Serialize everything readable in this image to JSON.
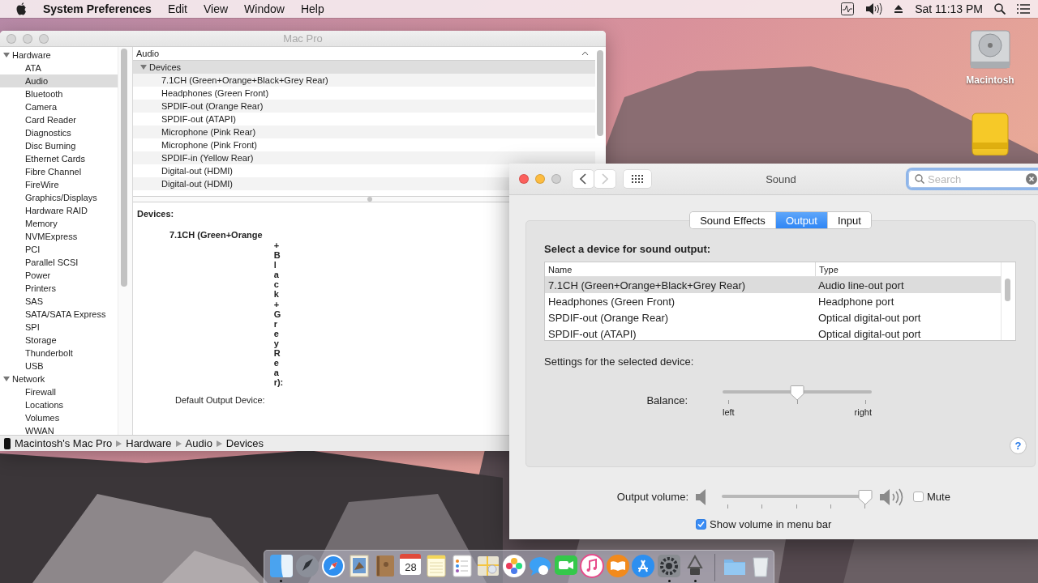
{
  "menu_bar": {
    "app_name": "System Preferences",
    "menus": [
      "Edit",
      "View",
      "Window",
      "Help"
    ],
    "clock": "Sat 11:13 PM"
  },
  "desktop_icons": [
    {
      "kind": "internal-drive",
      "label": "Macintosh"
    },
    {
      "kind": "external-drive"
    }
  ],
  "info_window": {
    "title": "Mac Pro",
    "sidebar": [
      {
        "label": "Hardware",
        "expanded": true,
        "children": [
          {
            "label": "ATA",
            "selected": false
          },
          {
            "label": "Audio",
            "selected": true
          },
          {
            "label": "Bluetooth",
            "selected": false
          },
          {
            "label": "Camera",
            "selected": false
          },
          {
            "label": "Card Reader",
            "selected": false
          },
          {
            "label": "Diagnostics",
            "selected": false
          },
          {
            "label": "Disc Burning",
            "selected": false
          },
          {
            "label": "Ethernet Cards",
            "selected": false
          },
          {
            "label": "Fibre Channel",
            "selected": false
          },
          {
            "label": "FireWire",
            "selected": false
          },
          {
            "label": "Graphics/Displays",
            "selected": false
          },
          {
            "label": "Hardware RAID",
            "selected": false
          },
          {
            "label": "Memory",
            "selected": false
          },
          {
            "label": "NVMExpress",
            "selected": false
          },
          {
            "label": "PCI",
            "selected": false
          },
          {
            "label": "Parallel SCSI",
            "selected": false
          },
          {
            "label": "Power",
            "selected": false
          },
          {
            "label": "Printers",
            "selected": false
          },
          {
            "label": "SAS",
            "selected": false
          },
          {
            "label": "SATA/SATA Express",
            "selected": false
          },
          {
            "label": "SPI",
            "selected": false
          },
          {
            "label": "Storage",
            "selected": false
          },
          {
            "label": "Thunderbolt",
            "selected": false
          },
          {
            "label": "USB",
            "selected": false
          }
        ]
      },
      {
        "label": "Network",
        "expanded": true,
        "children": [
          {
            "label": "Firewall",
            "selected": false
          },
          {
            "label": "Locations",
            "selected": false
          },
          {
            "label": "Volumes",
            "selected": false
          },
          {
            "label": "WWAN",
            "selected": false
          }
        ]
      }
    ],
    "list_header": "Audio",
    "list": [
      {
        "label": "Devices",
        "expanded": true,
        "children": [
          {
            "label": "7.1CH (Green+Orange+Black+Grey Rear)"
          },
          {
            "label": "Headphones (Green Front)"
          },
          {
            "label": "SPDIF-out (Orange Rear)"
          },
          {
            "label": "SPDIF-out (ATAPI)"
          },
          {
            "label": "Microphone (Pink Rear)"
          },
          {
            "label": "Microphone (Pink Front)"
          },
          {
            "label": "SPDIF-in (Yellow Rear)"
          },
          {
            "label": "Digital-out (HDMI)"
          },
          {
            "label": "Digital-out (HDMI)"
          }
        ]
      }
    ],
    "detail": {
      "heading": "Devices:",
      "device_name": "7.1CH (Green+Orange",
      "device_name_wrapped": "+Black+GreyRear):",
      "next_label": "Default Output Device:"
    },
    "path": [
      "Macintosh's Mac Pro",
      "Hardware",
      "Audio",
      "Devices"
    ]
  },
  "sound_window": {
    "title": "Sound",
    "nav": [
      {
        "kind": "back",
        "disabled": false
      },
      {
        "kind": "forward",
        "disabled": true
      }
    ],
    "search": {
      "placeholder": "Search"
    },
    "tabs": [
      {
        "label": "Sound Effects",
        "selected": false
      },
      {
        "label": "Output",
        "selected": true
      },
      {
        "label": "Input",
        "selected": false
      }
    ],
    "heading": "Select a device for sound output:",
    "table": {
      "columns": [
        "Name",
        "Type"
      ],
      "rows": [
        {
          "name": "7.1CH (Green+Orange+Black+Grey Rear)",
          "type": "Audio line-out port",
          "selected": true
        },
        {
          "name": "Headphones (Green Front)",
          "type": "Headphone port",
          "selected": false
        },
        {
          "name": "SPDIF-out (Orange Rear)",
          "type": "Optical digital-out port",
          "selected": false
        },
        {
          "name": "SPDIF-out (ATAPI)",
          "type": "Optical digital-out port",
          "selected": false
        }
      ]
    },
    "settings_label": "Settings for the selected device:",
    "balance": {
      "label": "Balance:",
      "level": 0.5,
      "min_label": "left",
      "max_label": "right"
    },
    "help": "?",
    "output_volume": {
      "label": "Output volume:",
      "level": 0.96
    },
    "mute": {
      "label": "Mute",
      "checked": false
    },
    "show_in_menu_bar": {
      "label": "Show volume in menu bar",
      "checked": true
    }
  },
  "dock": [
    {
      "kind": "finder",
      "running": true
    },
    {
      "kind": "launchpad"
    },
    {
      "kind": "safari"
    },
    {
      "kind": "mail"
    },
    {
      "kind": "contacts"
    },
    {
      "kind": "calendar",
      "date": "28"
    },
    {
      "kind": "notes"
    },
    {
      "kind": "reminders"
    },
    {
      "kind": "maps"
    },
    {
      "kind": "photos"
    },
    {
      "kind": "messages"
    },
    {
      "kind": "facetime"
    },
    {
      "kind": "music"
    },
    {
      "kind": "books"
    },
    {
      "kind": "store"
    },
    {
      "kind": "settings",
      "running": true
    },
    {
      "kind": "utility",
      "running": true
    },
    {
      "kind": "divider"
    },
    {
      "kind": "folder"
    },
    {
      "kind": "trash"
    }
  ]
}
